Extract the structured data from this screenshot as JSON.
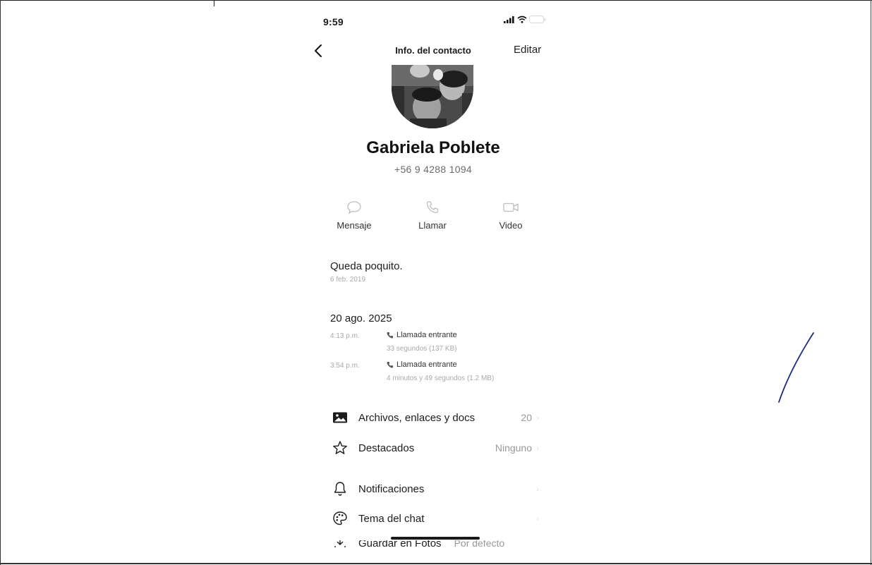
{
  "status_bar": {
    "time": "9:59"
  },
  "nav": {
    "title": "Info. del contacto",
    "edit_label": "Editar"
  },
  "contact": {
    "name": "Gabriela Poblete",
    "phone": "+56 9 4288 1094"
  },
  "actions": [
    {
      "label": "Mensaje",
      "icon": "chat-bubble-icon"
    },
    {
      "label": "Llamar",
      "icon": "phone-icon"
    },
    {
      "label": "Video",
      "icon": "video-camera-icon"
    }
  ],
  "about": {
    "text": "Queda poquito.",
    "date": "6 feb. 2019"
  },
  "calls": {
    "date": "20 ago. 2025",
    "items": [
      {
        "time": "4:13 p.m.",
        "type": "Llamada entrante",
        "detail": "33 segundos (137 KB)"
      },
      {
        "time": "3:54 p.m.",
        "type": "Llamada entrante",
        "detail": "4 minutos y 49 segundos (1.2 MB)"
      }
    ]
  },
  "rows": [
    {
      "label": "Archivos, enlaces y docs",
      "value": "20",
      "icon": "photo-icon"
    },
    {
      "label": "Destacados",
      "value": "Ninguno",
      "icon": "star-icon"
    },
    {
      "label": "Notificaciones",
      "value": "",
      "icon": "bell-icon"
    },
    {
      "label": "Tema del chat",
      "value": "",
      "icon": "palette-icon"
    }
  ],
  "partial_row": {
    "label": "Guardar en Fotos",
    "value": "Por defecto"
  }
}
